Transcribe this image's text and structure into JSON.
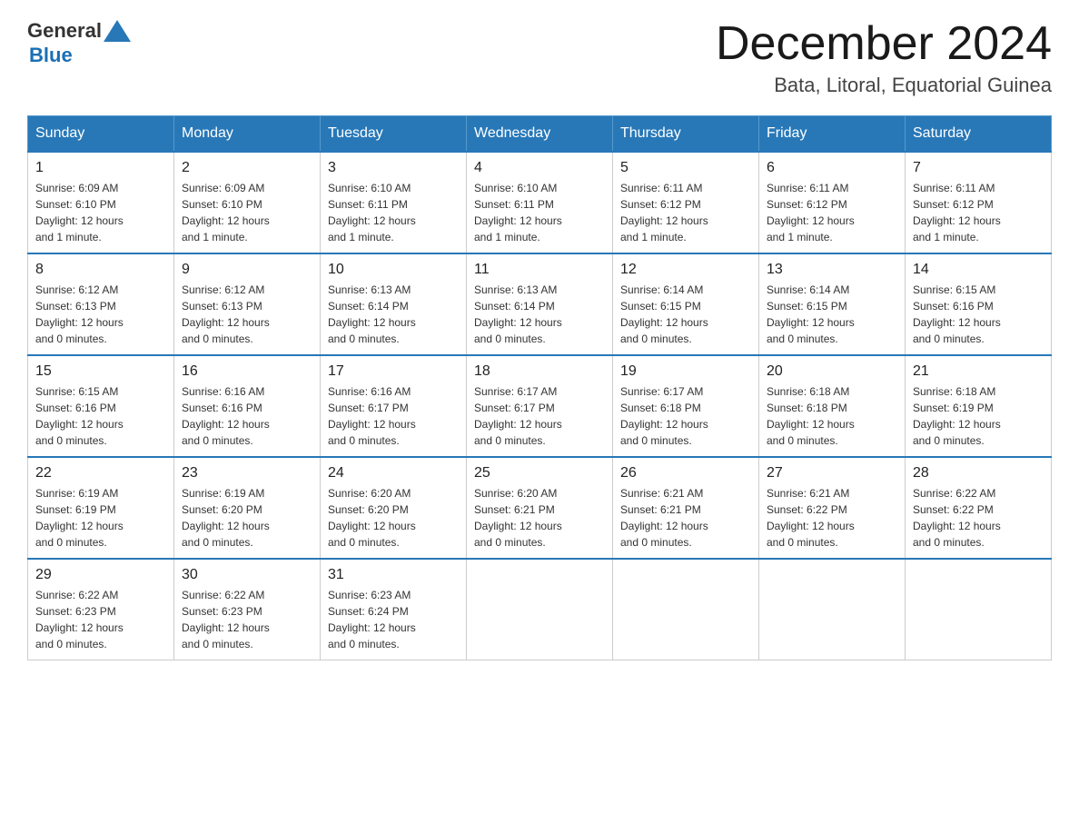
{
  "header": {
    "logo": {
      "text_general": "General",
      "text_blue": "Blue",
      "aria": "GeneralBlue logo"
    },
    "month_title": "December 2024",
    "location": "Bata, Litoral, Equatorial Guinea"
  },
  "days_of_week": [
    "Sunday",
    "Monday",
    "Tuesday",
    "Wednesday",
    "Thursday",
    "Friday",
    "Saturday"
  ],
  "weeks": [
    [
      {
        "day": "1",
        "sunrise": "6:09 AM",
        "sunset": "6:10 PM",
        "daylight": "12 hours and 1 minute."
      },
      {
        "day": "2",
        "sunrise": "6:09 AM",
        "sunset": "6:10 PM",
        "daylight": "12 hours and 1 minute."
      },
      {
        "day": "3",
        "sunrise": "6:10 AM",
        "sunset": "6:11 PM",
        "daylight": "12 hours and 1 minute."
      },
      {
        "day": "4",
        "sunrise": "6:10 AM",
        "sunset": "6:11 PM",
        "daylight": "12 hours and 1 minute."
      },
      {
        "day": "5",
        "sunrise": "6:11 AM",
        "sunset": "6:12 PM",
        "daylight": "12 hours and 1 minute."
      },
      {
        "day": "6",
        "sunrise": "6:11 AM",
        "sunset": "6:12 PM",
        "daylight": "12 hours and 1 minute."
      },
      {
        "day": "7",
        "sunrise": "6:11 AM",
        "sunset": "6:12 PM",
        "daylight": "12 hours and 1 minute."
      }
    ],
    [
      {
        "day": "8",
        "sunrise": "6:12 AM",
        "sunset": "6:13 PM",
        "daylight": "12 hours and 0 minutes."
      },
      {
        "day": "9",
        "sunrise": "6:12 AM",
        "sunset": "6:13 PM",
        "daylight": "12 hours and 0 minutes."
      },
      {
        "day": "10",
        "sunrise": "6:13 AM",
        "sunset": "6:14 PM",
        "daylight": "12 hours and 0 minutes."
      },
      {
        "day": "11",
        "sunrise": "6:13 AM",
        "sunset": "6:14 PM",
        "daylight": "12 hours and 0 minutes."
      },
      {
        "day": "12",
        "sunrise": "6:14 AM",
        "sunset": "6:15 PM",
        "daylight": "12 hours and 0 minutes."
      },
      {
        "day": "13",
        "sunrise": "6:14 AM",
        "sunset": "6:15 PM",
        "daylight": "12 hours and 0 minutes."
      },
      {
        "day": "14",
        "sunrise": "6:15 AM",
        "sunset": "6:16 PM",
        "daylight": "12 hours and 0 minutes."
      }
    ],
    [
      {
        "day": "15",
        "sunrise": "6:15 AM",
        "sunset": "6:16 PM",
        "daylight": "12 hours and 0 minutes."
      },
      {
        "day": "16",
        "sunrise": "6:16 AM",
        "sunset": "6:16 PM",
        "daylight": "12 hours and 0 minutes."
      },
      {
        "day": "17",
        "sunrise": "6:16 AM",
        "sunset": "6:17 PM",
        "daylight": "12 hours and 0 minutes."
      },
      {
        "day": "18",
        "sunrise": "6:17 AM",
        "sunset": "6:17 PM",
        "daylight": "12 hours and 0 minutes."
      },
      {
        "day": "19",
        "sunrise": "6:17 AM",
        "sunset": "6:18 PM",
        "daylight": "12 hours and 0 minutes."
      },
      {
        "day": "20",
        "sunrise": "6:18 AM",
        "sunset": "6:18 PM",
        "daylight": "12 hours and 0 minutes."
      },
      {
        "day": "21",
        "sunrise": "6:18 AM",
        "sunset": "6:19 PM",
        "daylight": "12 hours and 0 minutes."
      }
    ],
    [
      {
        "day": "22",
        "sunrise": "6:19 AM",
        "sunset": "6:19 PM",
        "daylight": "12 hours and 0 minutes."
      },
      {
        "day": "23",
        "sunrise": "6:19 AM",
        "sunset": "6:20 PM",
        "daylight": "12 hours and 0 minutes."
      },
      {
        "day": "24",
        "sunrise": "6:20 AM",
        "sunset": "6:20 PM",
        "daylight": "12 hours and 0 minutes."
      },
      {
        "day": "25",
        "sunrise": "6:20 AM",
        "sunset": "6:21 PM",
        "daylight": "12 hours and 0 minutes."
      },
      {
        "day": "26",
        "sunrise": "6:21 AM",
        "sunset": "6:21 PM",
        "daylight": "12 hours and 0 minutes."
      },
      {
        "day": "27",
        "sunrise": "6:21 AM",
        "sunset": "6:22 PM",
        "daylight": "12 hours and 0 minutes."
      },
      {
        "day": "28",
        "sunrise": "6:22 AM",
        "sunset": "6:22 PM",
        "daylight": "12 hours and 0 minutes."
      }
    ],
    [
      {
        "day": "29",
        "sunrise": "6:22 AM",
        "sunset": "6:23 PM",
        "daylight": "12 hours and 0 minutes."
      },
      {
        "day": "30",
        "sunrise": "6:22 AM",
        "sunset": "6:23 PM",
        "daylight": "12 hours and 0 minutes."
      },
      {
        "day": "31",
        "sunrise": "6:23 AM",
        "sunset": "6:24 PM",
        "daylight": "12 hours and 0 minutes."
      },
      null,
      null,
      null,
      null
    ]
  ],
  "labels": {
    "sunrise": "Sunrise:",
    "sunset": "Sunset:",
    "daylight": "Daylight:"
  }
}
